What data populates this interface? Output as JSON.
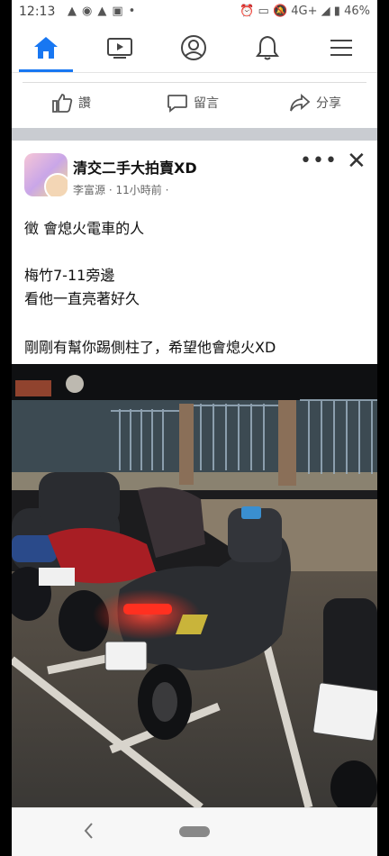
{
  "status_bar": {
    "time": "12:13",
    "right_text": "4G+",
    "battery": "46%"
  },
  "nav": {
    "items": [
      {
        "name": "home",
        "icon": "home-icon",
        "active": true
      },
      {
        "name": "watch",
        "icon": "video-icon"
      },
      {
        "name": "profile",
        "icon": "profile-icon"
      },
      {
        "name": "notifications",
        "icon": "bell-icon"
      },
      {
        "name": "menu",
        "icon": "menu-icon"
      }
    ],
    "accent": "#1877f2"
  },
  "actions": {
    "like_label": "讚",
    "comment_label": "留言",
    "share_label": "分享"
  },
  "post": {
    "group_name": "清交二手大拍賣XD",
    "author": "李富源",
    "time": "11小時前",
    "lines": [
      "徵 會熄火電車的人",
      "梅竹7-11旁邊",
      "看他一直亮著好久",
      "剛剛有幫你踢側柱了，希望他會熄火XD"
    ]
  },
  "photo": {
    "plate_center": "ENH-0695",
    "plate_left": "532-NGL",
    "plate_right": "159-CNW"
  }
}
